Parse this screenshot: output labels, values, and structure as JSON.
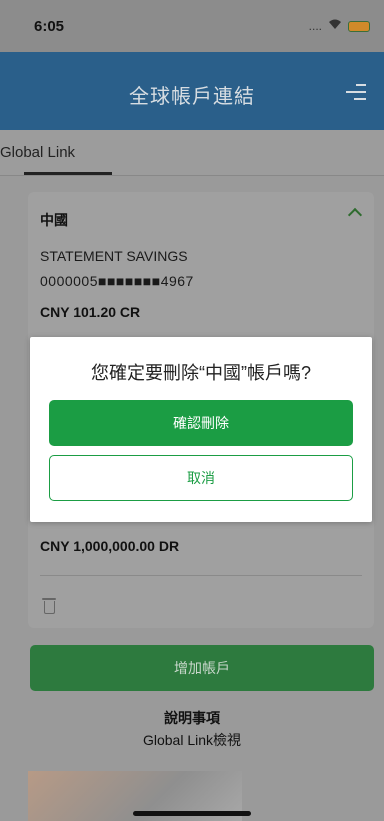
{
  "status_bar": {
    "time": "6:05",
    "signal": "....",
    "wifi_icon": "wifi-icon",
    "battery_icon": "battery-icon"
  },
  "header": {
    "title": "全球帳戶連結",
    "menu_icon": "menu-icon"
  },
  "tabs": [
    {
      "label": "Global Link",
      "active": true
    }
  ],
  "account_card": {
    "title": "中國",
    "account_type": "STATEMENT SAVINGS",
    "account_number": "0000005■■■■■■■4967",
    "balance": "CNY 101.20 CR",
    "balance_2": "CNY 1,000,000.00 DR"
  },
  "add_account_label": "增加帳戶",
  "notes": {
    "title": "說明事項",
    "subtitle": "Global Link檢視"
  },
  "dialog": {
    "message": "您確定要刪除“中國”帳戶嗎?",
    "confirm_label": "確認刪除",
    "cancel_label": "取消"
  },
  "colors": {
    "header_bg": "#2a5f8a",
    "primary_green": "#1b9d44",
    "overlay_dim": "#9a9a9a"
  }
}
